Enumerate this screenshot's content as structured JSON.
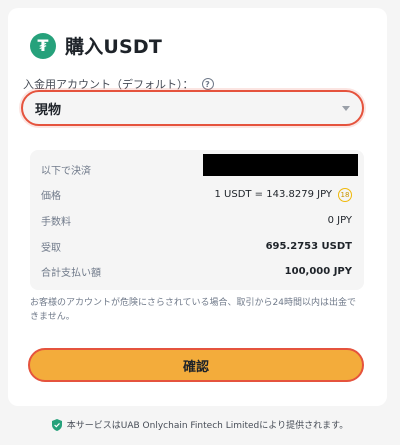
{
  "header": {
    "coin_icon": "tether-icon",
    "coin_symbol": "₮",
    "title": "購入USDT"
  },
  "account": {
    "label": "入金用アカウント（デフォルト）：",
    "help_icon": "question-circle-icon",
    "help_glyph": "?",
    "selected": "現物"
  },
  "summary": {
    "pay_label": "以下で決済",
    "price_label": "価格",
    "price_value": "1 USDT = 143.8279 JPY",
    "countdown": "18",
    "fee_label": "手数料",
    "fee_value": "0 JPY",
    "receive_label": "受取",
    "receive_value": "695.2753 USDT",
    "total_label": "合計支払い額",
    "total_value": "100,000 JPY"
  },
  "notice": "お客様のアカウントが危険にさらされている場合、取引から24時間以内は出金できません。",
  "confirm_label": "確認",
  "footer": "本サービスはUAB Onlychain Fintech Limitedにより提供されます。",
  "colors": {
    "accent": "#f3ac3b",
    "highlight_border": "#e5533d",
    "tether": "#26a17b"
  }
}
